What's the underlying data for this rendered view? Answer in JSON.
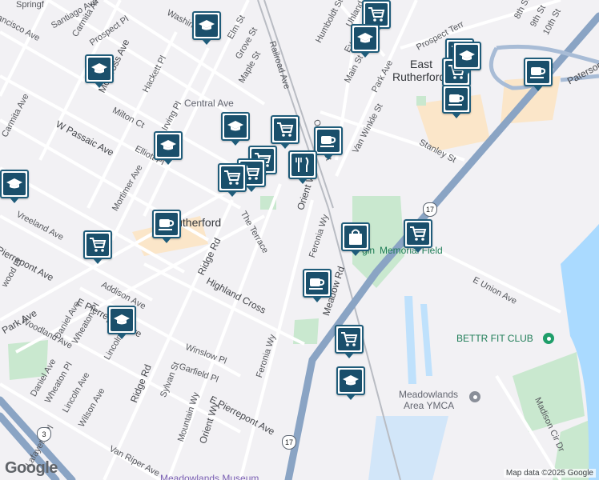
{
  "map": {
    "colors": {
      "land": "#f2f1f4",
      "highway": "#8aa4c4",
      "park": "#c9e8cf",
      "water": "#aadaff",
      "commercial": "#fbe6c9",
      "pin_fill": "#1a4f6b"
    },
    "towns": {
      "rutherford": "Rutherford",
      "east_rutherford_1": "East",
      "east_rutherford_2": "Rutherford"
    },
    "streets": {
      "montross": "Montross Ave",
      "w_passaic": "W Passaic Ave",
      "milton": "Milton Ct",
      "hackett": "Hackett Pl",
      "elliott": "Elliott Pl",
      "irving": "Irving Pl",
      "carmita_1": "Carmita Ave",
      "carmita_2": "Carmita Ave",
      "prospect": "Prospect Pl",
      "santiago": "Santiago Ave",
      "francisco": "ancisco Ave",
      "springfield": "Springf",
      "washington": "Washingt",
      "elm": "Elm St",
      "grove": "Grove St",
      "maple": "Maple St",
      "railroad": "Railroad Ave",
      "humboldt": "Humboldt St",
      "uhland": "Uhland St",
      "everett": "Everett",
      "main": "Main St",
      "park": "Park Ave",
      "orchard": "Orchard St",
      "van_winkle": "Van Winkle St",
      "stanley": "Stanley St",
      "prospect_terr": "Prospect Terr",
      "eighth": "8th St",
      "ninth": "9th St",
      "tenth": "10th St",
      "paterson": "Paterson",
      "vreeland": "Vreeland Ave",
      "mortimer": "Mortimer Ave",
      "pierrepont": "Pierrepont Ave",
      "wood": "wood Pl",
      "ridge_1": "Ridge Rd",
      "ridge_2": "Ridge Rd",
      "the_terrace": "The Terrace",
      "orient_1": "Orient Wy",
      "orient_2": "Orient Wy",
      "feronia_1": "Feronia Wy",
      "feronia_2": "Feronia Wy",
      "meadow": "Meadow Rd",
      "highland": "Highland Cross",
      "addison": "Addison Ave",
      "e_pierrepont_1": "E Pierrepont Ave",
      "e_pierrepont_2": "E Pierrepont Ave",
      "park_ave_w": "Park Ave",
      "woodland": "Woodland Ave",
      "daniel_1": "Daniel Ave",
      "daniel_2": "Daniel Ave",
      "wheaton_1": "Wheaton Pl",
      "wheaton_2": "Wheaton Pl",
      "lincoln_1": "Lincoln Ave",
      "lincoln_2": "Lincoln Ave",
      "wilson": "Wilson Ave",
      "lafayette": "Lafayette Pl",
      "winslow": "Winslow Pl",
      "garfield": "Garfield Pl",
      "sylvan": "Sylvan St",
      "mountain": "Mountain Wy",
      "van_riper": "Van Riper Ave",
      "e_union": "E Union Ave",
      "madison": "Madison Cir Dr"
    },
    "places": {
      "central_ave": "Central Ave",
      "field": "Memorial Field",
      "field_prefix": "gin",
      "bettr": "BETTR FIT CLUB",
      "ymca_1": "Meadowlands",
      "ymca_2": "Area YMCA",
      "museum": "Meadowlands Museum"
    },
    "shields": {
      "r17a": "17",
      "r17b": "17",
      "r3": "3"
    },
    "pins": [
      {
        "icon": "graduation-cap-icon"
      },
      {
        "icon": "shopping-cart-icon"
      },
      {
        "icon": "graduation-cap-icon"
      },
      {
        "icon": "graduation-cap-icon"
      },
      {
        "icon": "shopping-cart-icon"
      },
      {
        "icon": "shopping-cart-icon"
      },
      {
        "icon": "coffee-cup-icon"
      },
      {
        "icon": "coffee-cup-icon"
      },
      {
        "icon": "graduation-cap-icon"
      },
      {
        "icon": "graduation-cap-icon"
      },
      {
        "icon": "shopping-cart-icon"
      },
      {
        "icon": "coffee-cup-icon"
      },
      {
        "icon": "restaurant-icon"
      },
      {
        "icon": "shopping-cart-icon"
      },
      {
        "icon": "shopping-cart-icon"
      },
      {
        "icon": "shopping-cart-icon"
      },
      {
        "icon": "graduation-cap-icon"
      },
      {
        "icon": "coffee-cup-icon"
      },
      {
        "icon": "shopping-cart-icon"
      },
      {
        "icon": "shopping-bag-icon"
      },
      {
        "icon": "shopping-cart-icon"
      },
      {
        "icon": "coffee-cup-icon"
      },
      {
        "icon": "graduation-cap-icon"
      },
      {
        "icon": "shopping-cart-icon"
      },
      {
        "icon": "graduation-cap-icon"
      },
      {
        "icon": "graduation-cap-icon"
      }
    ],
    "google_logo": "Google",
    "attribution": "Map data ©2025 Google"
  }
}
